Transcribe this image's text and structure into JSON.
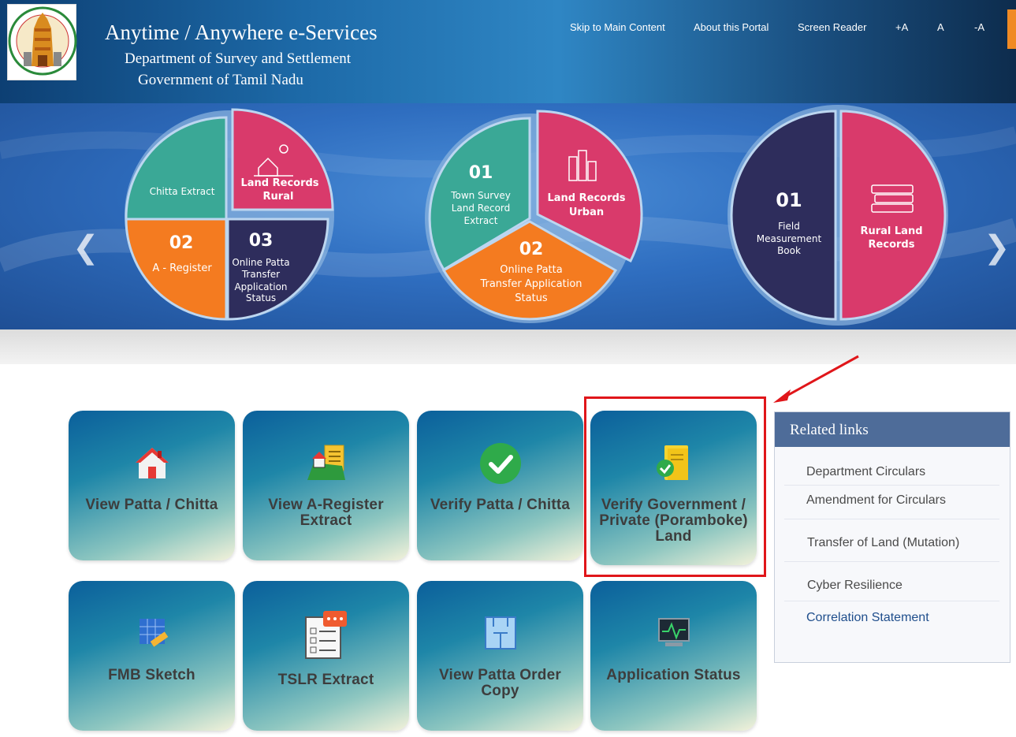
{
  "header": {
    "title": "Anytime / Anywhere e-Services",
    "subtitle1": "Department of Survey and Settlement",
    "subtitle2": "Government of Tamil Nadu",
    "nav": [
      "Skip to Main Content",
      "About this Portal",
      "Screen Reader",
      "+A",
      "A",
      "-A"
    ]
  },
  "banner": {
    "prev_icon": "chevron-left-icon",
    "next_icon": "chevron-right-icon",
    "pie1": {
      "chitta": "Chitta Extract",
      "land_rural": [
        "Land Records",
        "Rural"
      ],
      "a_register_num": "02",
      "a_register": "A - Register",
      "transfer_num": "03",
      "transfer": [
        "Online Patta",
        "Transfer",
        "Application",
        "Status"
      ]
    },
    "pie2": {
      "town_num": "01",
      "town": [
        "Town Survey",
        "Land Record",
        "Extract"
      ],
      "land_urban": [
        "Land Records",
        "Urban"
      ],
      "online_num": "02",
      "online": [
        "Online Patta",
        "Transfer Application",
        "Status"
      ]
    },
    "pie3": {
      "field_num": "01",
      "field": [
        "Field",
        "Measurement",
        "Book"
      ],
      "rural": [
        "Rural Land",
        "Records"
      ]
    }
  },
  "services": {
    "row1": [
      {
        "label": "View Patta / Chitta",
        "icon": "house-icon"
      },
      {
        "label": "View A-Register Extract",
        "icon": "land-document-icon"
      },
      {
        "label": "Verify Patta / Chitta",
        "icon": "check-circle-icon"
      },
      {
        "label": "Verify Government / Private (Poramboke) Land",
        "icon": "verified-document-icon"
      }
    ],
    "row2": [
      {
        "label": "FMB Sketch",
        "icon": "sketch-ruler-icon"
      },
      {
        "label": "TSLR Extract",
        "icon": "checklist-icon"
      },
      {
        "label": "View Patta Order Copy",
        "icon": "order-copy-icon"
      },
      {
        "label": "Application Status",
        "icon": "monitor-pulse-icon"
      }
    ]
  },
  "related": {
    "title": "Related links",
    "links": [
      "Department Circulars",
      "Amendment for Circulars",
      "Transfer of Land (Mutation)",
      "Cyber Resilience",
      "Correlation Statement"
    ]
  },
  "colors": {
    "highlight": "#e0161a",
    "teal": "#3aa896",
    "pink": "#d93a6b",
    "orange": "#f47b20",
    "navy": "#2e2d5c"
  }
}
